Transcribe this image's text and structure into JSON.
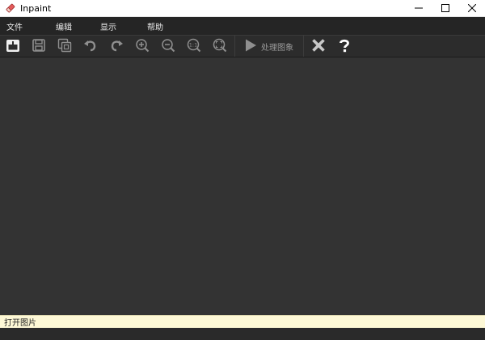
{
  "window": {
    "title": "Inpaint",
    "app_icon": "eraser-icon",
    "controls": [
      "minimize-icon",
      "maximize-icon",
      "close-icon"
    ]
  },
  "menu": {
    "items": [
      {
        "label": "文件"
      },
      {
        "label": "编辑"
      },
      {
        "label": "显示"
      },
      {
        "label": "帮助"
      }
    ]
  },
  "toolbar": {
    "buttons": [
      {
        "icon": "open-file-icon"
      },
      {
        "icon": "save-icon"
      },
      {
        "icon": "save-as-icon"
      },
      {
        "icon": "undo-icon"
      },
      {
        "icon": "redo-icon"
      },
      {
        "icon": "zoom-in-icon"
      },
      {
        "icon": "zoom-out-icon"
      },
      {
        "icon": "zoom-actual-size-icon"
      },
      {
        "icon": "zoom-fit-icon"
      }
    ],
    "process": {
      "label": "处理图象",
      "icon": "play-icon"
    },
    "cancel_icon": "x-icon",
    "help_icon": "question-icon"
  },
  "status": {
    "text": "打开图片"
  },
  "colors": {
    "menubar_bg": "#252525",
    "toolbar_bg": "#2c2c2c",
    "canvas_bg": "#333333",
    "statusbar_bg": "#fdf8d6",
    "icon_color": "#9a9a9a"
  }
}
